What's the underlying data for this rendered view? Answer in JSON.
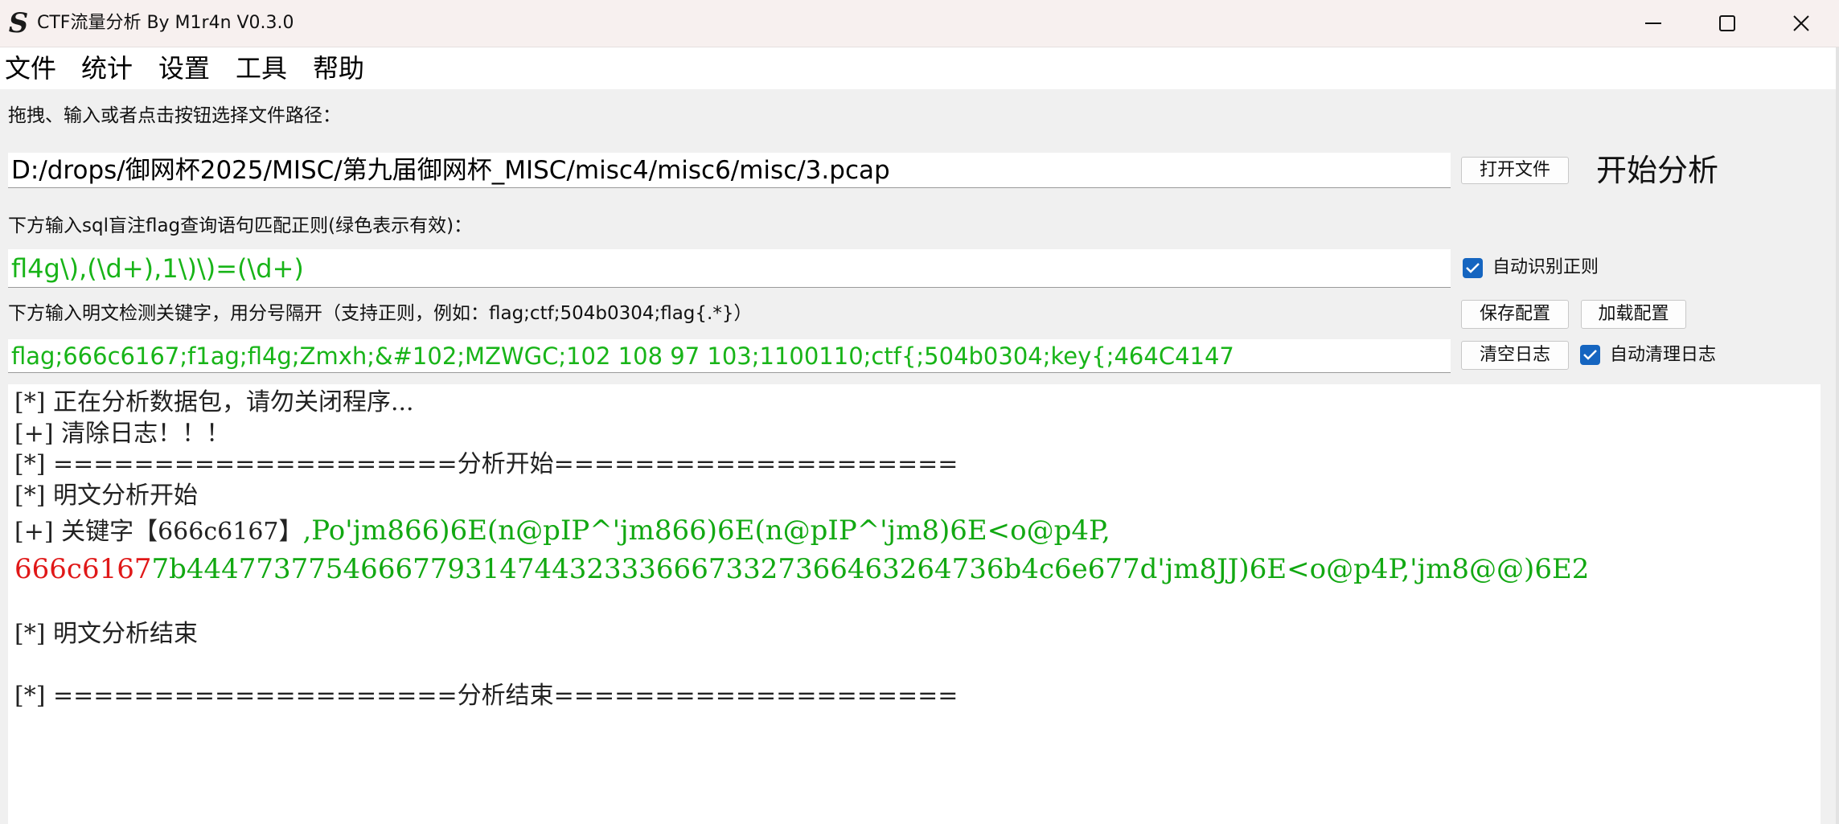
{
  "window": {
    "title": "CTF流量分析 By M1r4n V0.3.0",
    "icon": "S"
  },
  "menu": [
    "文件",
    "统计",
    "设置",
    "工具",
    "帮助"
  ],
  "labels": {
    "file_prompt": "拖拽、输入或者点击按钮选择文件路径：",
    "regex_prompt": "下方输入sql盲注flag查询语句匹配正则(绿色表示有效)：",
    "keyword_prompt": "下方输入明文检测关键字，用分号隔开（支持正则，例如：flag;ctf;504b0304;flag{.*}）"
  },
  "inputs": {
    "file_path": "D:/drops/御网杯2025/MISC/第九届御网杯_MISC/misc4/misc6/misc/3.pcap",
    "regex": "fl4g\\),(\\d+),1\\)\\)=(\\d+)",
    "keywords": "flag;666c6167;f1ag;fl4g;Zmxh;&#102;MZWGC;102 108 97 103;1100110;ctf{;504b0304;key{;464C4147"
  },
  "buttons": {
    "open_file": "打开文件",
    "start_analysis": "开始分析",
    "save_config": "保存配置",
    "load_config": "加载配置",
    "clear_log": "清空日志"
  },
  "checkboxes": {
    "auto_regex": {
      "label": "自动识别正则",
      "checked": true
    },
    "auto_clear_log": {
      "label": "自动清理日志",
      "checked": true
    }
  },
  "log": {
    "l1": "[*] 正在分析数据包，请勿关闭程序...",
    "l2": "[+] 清除日志！！！",
    "l3": "[*] ====================分析开始====================",
    "l4": "[*] 明文分析开始",
    "l5_prefix": "[+] 关键字【666c6167】",
    "l5_value": ",Po'jm866)6E(n@pIP^'jm866)6E(n@pIP^'jm8)6E<o@p4P,",
    "l6_match": "666c6167",
    "l6_value": "7b44477377546667793147443233366673327366463264736b4c6e677d'jm8JJ)6E<o@p4P,'jm8@@)6E2",
    "l7": "[*] 明文分析结束",
    "l8": "[*] ====================分析结束===================="
  },
  "colors": {
    "valid_green": "#18b418",
    "match_red": "#e01818",
    "checkbox_blue": "#1565c0"
  }
}
